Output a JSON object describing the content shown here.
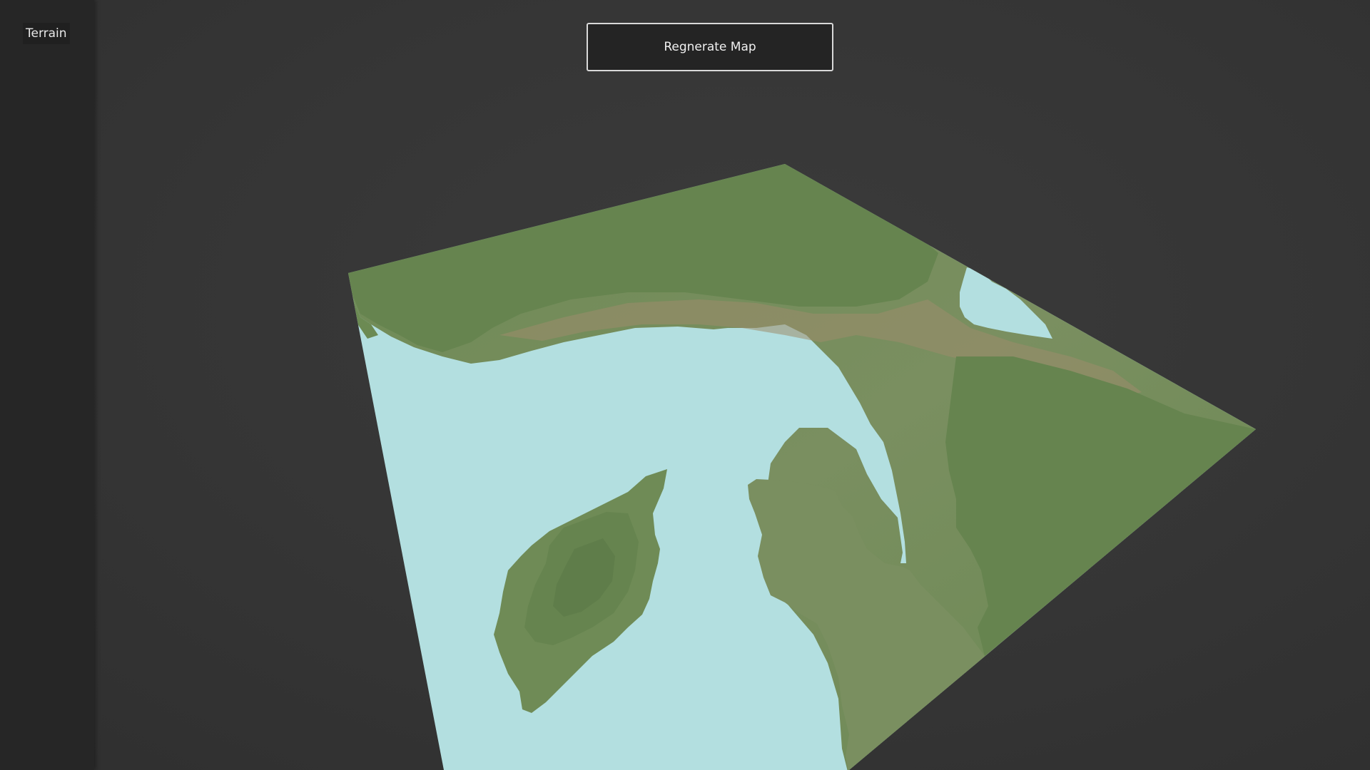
{
  "sidebar": {
    "items": [
      {
        "label": "Terrain"
      }
    ]
  },
  "toolbar": {
    "regenerate_label": "Regnerate Map"
  },
  "scene": {
    "colors": {
      "background": "#353535",
      "sidebar": "#262626",
      "water": "#b3dfe0",
      "land_dark": "#66844f",
      "land_mid": "#7a8f60",
      "land_dirt": "#9c8c6c"
    }
  }
}
